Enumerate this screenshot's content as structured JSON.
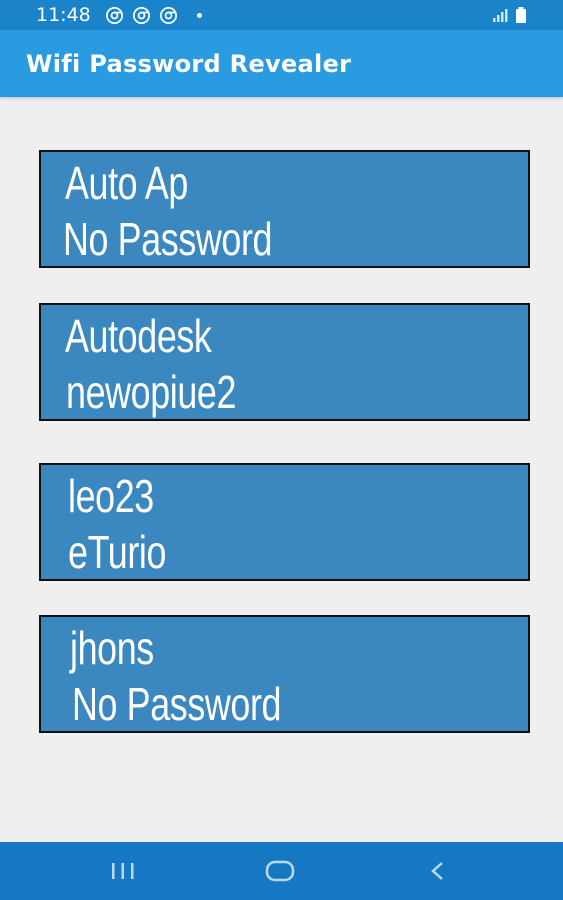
{
  "status_bar": {
    "time": "11:48",
    "notification_icons": [
      "chrome-icon",
      "chrome-icon",
      "chrome-icon",
      "dot-icon"
    ],
    "right_icons": [
      "signal-icon",
      "battery-icon"
    ]
  },
  "app_bar": {
    "title": "Wifi Password Revealer"
  },
  "networks": [
    {
      "name": "Auto Ap",
      "password": "No Password"
    },
    {
      "name": "Autodesk",
      "password": "newopiue2"
    },
    {
      "name": "leo23",
      "password": "eTurio"
    },
    {
      "name": "jhons",
      "password": "No Password"
    }
  ],
  "nav_bar": {
    "buttons": [
      "recent-apps-icon",
      "home-icon",
      "back-icon"
    ]
  },
  "colors": {
    "status_bar": "#1a83c9",
    "app_bar": "#2a9be0",
    "card": "#3b88c0",
    "nav_bar": "#1678c2",
    "background": "#efefef"
  }
}
